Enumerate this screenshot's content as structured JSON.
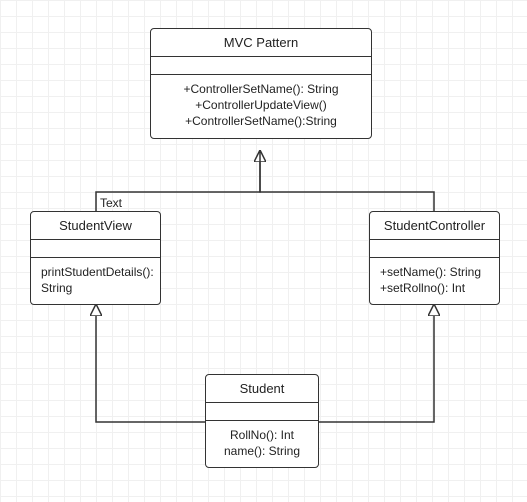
{
  "diagram": {
    "type": "uml-class",
    "title_label": "MVC Pattern",
    "classes": {
      "mvc": {
        "name": "MVC Pattern",
        "operations": [
          "+ControllerSetName(): String",
          "+ControllerUpdateView()",
          "+ControllerSetName():String"
        ]
      },
      "studentView": {
        "name": "StudentView",
        "operations": [
          "printStudentDetails():",
          "String"
        ]
      },
      "studentController": {
        "name": "StudentController",
        "operations": [
          "+setName(): String",
          "+setRollno(): Int"
        ]
      },
      "student": {
        "name": "Student",
        "operations": [
          "RollNo(): Int",
          "name(): String"
        ]
      }
    },
    "labels": {
      "text": "Text"
    }
  }
}
